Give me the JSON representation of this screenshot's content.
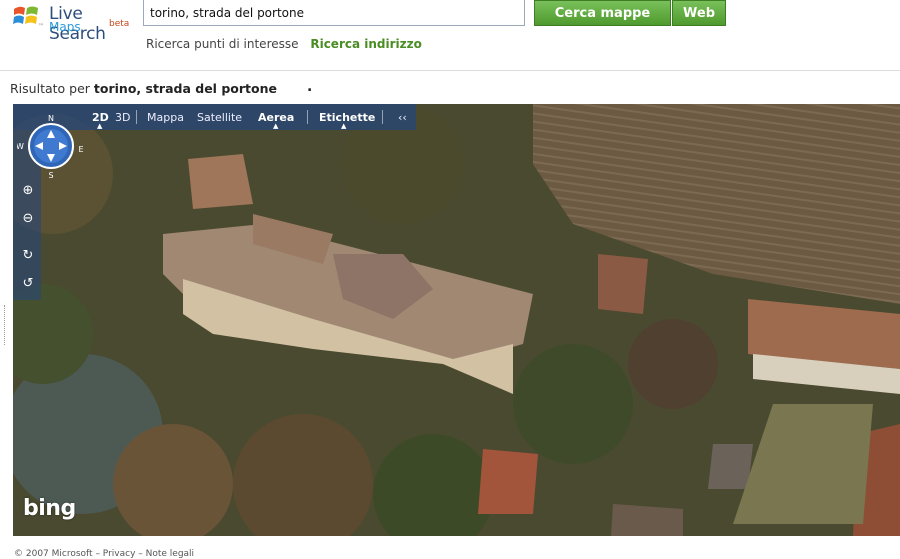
{
  "header": {
    "brand": "Live Search",
    "product": "Maps",
    "beta": "beta",
    "tm": "™",
    "search_value": "torino, strada del portone",
    "btn_maps": "Cerca mappe",
    "btn_web": "Web",
    "link_poi": "Ricerca punti di interesse",
    "link_address": "Ricerca indirizzo"
  },
  "result": {
    "prefix": "Risultato per",
    "query": "torino, strada del portone",
    "dot": "."
  },
  "map": {
    "view_2d": "2D",
    "view_3d": "3D",
    "mode_map": "Mappa",
    "mode_sat": "Satellite",
    "mode_aerial": "Aerea",
    "labels": "Etichette",
    "collapse": "‹‹",
    "compass": {
      "n": "N",
      "s": "S",
      "e": "E",
      "w": "W"
    },
    "watermark": "bing"
  },
  "footer": {
    "text": "© 2007 Microsoft – Privacy – Note legali"
  },
  "colors": {
    "accent_green": "#4f9a2e",
    "link_green": "#4a8d23",
    "toolbar_blue": "#264678"
  }
}
